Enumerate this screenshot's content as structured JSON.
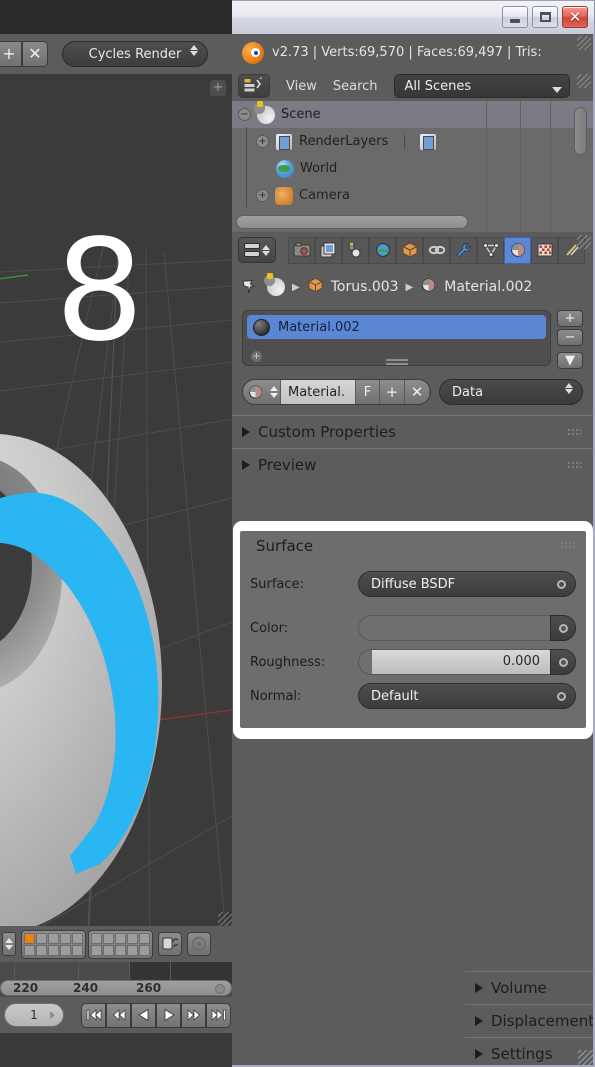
{
  "window": {
    "minimize_label": "—",
    "maximize_label": "□",
    "close_label": "✕"
  },
  "left_header": {
    "add_scene_label": "+",
    "remove_scene_label": "✕",
    "render_engine": "Cycles Render"
  },
  "viewport": {
    "overlay_number": "8",
    "add_button_label": "+"
  },
  "info_header": {
    "logo_icon": "blender-logo-icon",
    "stats": "v2.73 | Verts:69,570 | Faces:69,497 | Tris:"
  },
  "outliner": {
    "display_mode_icon": "outliner-display-mode-icon",
    "menus": [
      "View",
      "Search"
    ],
    "scene_filter": "All Scenes",
    "rows": [
      {
        "label": "Scene",
        "icon": "scene-icon",
        "indent": 0,
        "expander": "−",
        "selected": true
      },
      {
        "label": "RenderLayers",
        "icon": "renderlayers-icon",
        "indent": 1,
        "expander": "+",
        "selected": false
      },
      {
        "label": "World",
        "icon": "world-icon",
        "indent": 1,
        "expander": "",
        "selected": false
      },
      {
        "label": "Camera",
        "icon": "camera-icon",
        "indent": 1,
        "expander": "+",
        "selected": false
      }
    ]
  },
  "properties": {
    "editor_type_icon": "properties-editor-icon",
    "tabs": [
      {
        "name": "render",
        "icon": "camera-back-icon",
        "active": false
      },
      {
        "name": "render-layers",
        "icon": "render-layers-icon",
        "active": false
      },
      {
        "name": "scene",
        "icon": "scene-icon",
        "active": false
      },
      {
        "name": "world",
        "icon": "world-icon",
        "active": false
      },
      {
        "name": "object",
        "icon": "cube-icon",
        "active": false
      },
      {
        "name": "constraints",
        "icon": "chain-icon",
        "active": false
      },
      {
        "name": "modifiers",
        "icon": "wrench-icon",
        "active": false
      },
      {
        "name": "data",
        "icon": "mesh-data-icon",
        "active": false
      },
      {
        "name": "material",
        "icon": "material-sphere-icon",
        "active": true
      },
      {
        "name": "texture",
        "icon": "checker-icon",
        "active": false
      },
      {
        "name": "particles",
        "icon": "particles-icon",
        "active": false
      }
    ],
    "breadcrumb": {
      "pin_icon": "pin-icon",
      "scene_icon": "scene-icon",
      "object_icon": "cube-icon",
      "object_name": "Torus.003",
      "material_icon": "material-sphere-icon",
      "material_name": "Material.002"
    },
    "material_slots": {
      "selected_slot": "Material.002",
      "add_slot_label": "+",
      "remove_slot_label": "−",
      "specials_label": "▼",
      "dropdown_dot_label": "+"
    },
    "material_row": {
      "browse_icon": "material-sphere-icon",
      "name_value": "Material.",
      "fake_user_label": "F",
      "new_label": "+",
      "unlink_label": "✕",
      "link_mode": "Data"
    },
    "panels": [
      {
        "label": "Custom Properties",
        "expanded": false
      },
      {
        "label": "Preview",
        "expanded": false
      },
      {
        "label": "Volume",
        "expanded": false
      },
      {
        "label": "Displacement",
        "expanded": false
      },
      {
        "label": "Settings",
        "expanded": false
      }
    ],
    "surface_panel": {
      "title": "Surface",
      "expanded": true,
      "rows": [
        {
          "label": "Surface:",
          "type": "dropdown",
          "value": "Diffuse BSDF"
        },
        {
          "label": "Color:",
          "type": "color",
          "value": "",
          "swatch": "#6f6f6f"
        },
        {
          "label": "Roughness:",
          "type": "slider",
          "value": "0.000"
        },
        {
          "label": "Normal:",
          "type": "dropdown",
          "value": "Default"
        }
      ]
    }
  },
  "timeline": {
    "ticks": [
      "220",
      "240",
      "260"
    ],
    "current_frame": "1",
    "transport": [
      {
        "name": "jump-to-start",
        "label": "|◀◀"
      },
      {
        "name": "previous-keyframe",
        "label": "◀◀"
      },
      {
        "name": "play-reverse",
        "label": "◀"
      },
      {
        "name": "play",
        "label": "▶"
      },
      {
        "name": "next-keyframe",
        "label": "▶▶"
      },
      {
        "name": "jump-to-end",
        "label": "▶▶|"
      }
    ]
  },
  "colors": {
    "accent_blue": "#5b86d4",
    "selection_cyan": "#29b6f2",
    "panel_bg": "#5c5c5c",
    "surface_panel_bg": "#6d6d6d",
    "highlight_white": "#ffffff",
    "active_tab_blue": "#5b87d6"
  }
}
